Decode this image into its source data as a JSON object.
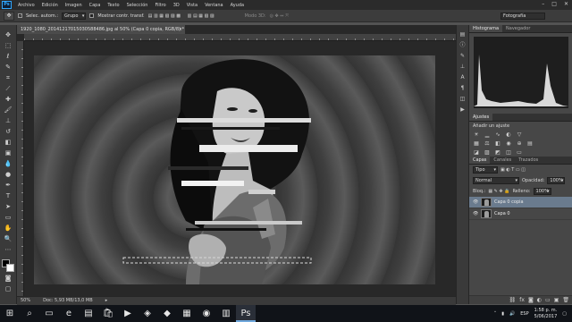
{
  "app": {
    "logo_text": "Ps",
    "menu": [
      "Archivo",
      "Edición",
      "Imagen",
      "Capa",
      "Texto",
      "Selección",
      "Filtro",
      "3D",
      "Vista",
      "Ventana",
      "Ayuda"
    ],
    "window_controls": [
      "–",
      "□",
      "✕"
    ]
  },
  "options": {
    "auto_select_label": "Selec. autom.:",
    "auto_select_value": "Grupo",
    "transform_label": "Mostrar contr. transf.",
    "mode_3d_label": "Modo 3D:",
    "workspace": "Fotografía"
  },
  "document": {
    "tab_title": "1920_1080_20141217015030588486.jpg al 50% (Capa 0 copia, RGB/8) *",
    "tab_close": "×",
    "zoom": "50%",
    "doc_size": "Doc: 5,93 MB/13,0 MB"
  },
  "panels": {
    "top_tabs": [
      "Histograma",
      "Navegador"
    ],
    "adjust_tab": "Ajustes",
    "adjust_title": "Añadir un ajuste",
    "layer_tabs": [
      "Capas",
      "Canales",
      "Trazados"
    ],
    "kind_filter": "Tipo",
    "blend_mode": "Normal",
    "opacity_label": "Opacidad:",
    "opacity_value": "100%",
    "lock_label": "Bloq.:",
    "fill_label": "Relleno:",
    "fill_value": "100%",
    "layers": [
      {
        "name": "Capa 0 copia",
        "selected": true
      },
      {
        "name": "Capa 0",
        "selected": false
      }
    ]
  },
  "taskbar": {
    "lang": "ESP",
    "time": "1:58 p. m.",
    "date": "5/06/2017"
  }
}
